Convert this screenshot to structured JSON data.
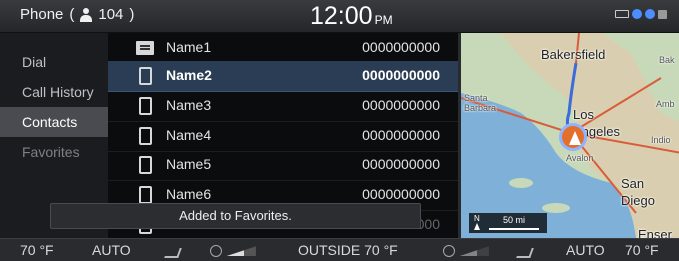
{
  "status": {
    "app_label": "Phone",
    "contact_count": "104",
    "time": "12:00",
    "ampm": "PM"
  },
  "menu": {
    "items": [
      {
        "label": "Dial"
      },
      {
        "label": "Call History"
      },
      {
        "label": "Contacts"
      },
      {
        "label": "Favorites"
      }
    ],
    "active_index": 2
  },
  "contacts": [
    {
      "name": "Name1",
      "number": "0000000000",
      "icon": "contact-card-icon"
    },
    {
      "name": "Name2",
      "number": "0000000000",
      "icon": "mobile-phone-icon"
    },
    {
      "name": "Name3",
      "number": "0000000000",
      "icon": "mobile-phone-icon"
    },
    {
      "name": "Name4",
      "number": "0000000000",
      "icon": "mobile-phone-icon"
    },
    {
      "name": "Name5",
      "number": "0000000000",
      "icon": "mobile-phone-icon"
    },
    {
      "name": "Name6",
      "number": "0000000000",
      "icon": "mobile-phone-icon"
    }
  ],
  "partial_row": {
    "name": "",
    "number": "0000000000"
  },
  "toast": "Added to Favorites.",
  "map": {
    "labels": {
      "bakersfield": "Bakersfield",
      "los_angeles_1": "Los",
      "los_angeles_2": "Angeles",
      "san_diego_1": "San",
      "san_diego_2": "Diego",
      "bak": "Bak",
      "amb": "Amb",
      "indio": "Indio",
      "santa": "Santa",
      "barbara": "Barbara",
      "avalon": "Avalon",
      "ensen": "Enser"
    },
    "scale": "50 mi",
    "north": "N"
  },
  "climate": {
    "left_temp": "70 °F",
    "left_mode": "AUTO",
    "outside": "OUTSIDE  70 °F",
    "right_mode": "AUTO",
    "right_temp": "70 °F"
  }
}
